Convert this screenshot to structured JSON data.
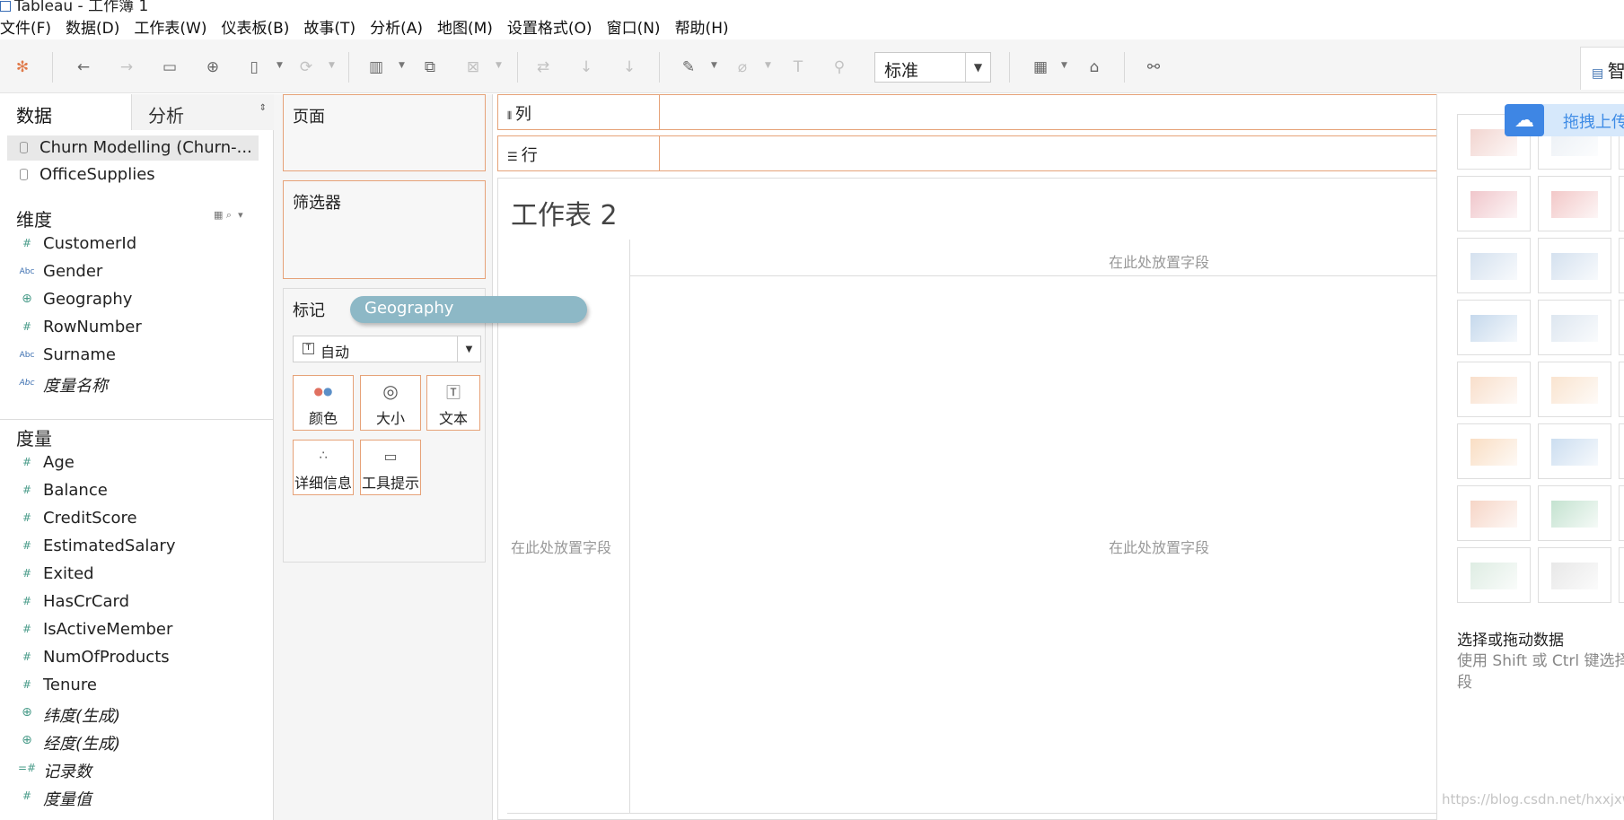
{
  "window": {
    "title": "Tableau - 工作簿 1"
  },
  "menu": [
    "文件(F)",
    "数据(D)",
    "工作表(W)",
    "仪表板(B)",
    "故事(T)",
    "分析(A)",
    "地图(M)",
    "设置格式(O)",
    "窗口(N)",
    "帮助(H)"
  ],
  "toolbar": {
    "view_mode": "标准",
    "smart_tab": "智"
  },
  "left_pane": {
    "tabs": {
      "data": "数据",
      "analysis": "分析"
    },
    "data_sources": [
      "Churn Modelling (Churn-...",
      "OfficeSupplies"
    ],
    "dimensions_header": "维度",
    "dimensions": [
      {
        "name": "CustomerId",
        "icon": "number-icon",
        "italic": false
      },
      {
        "name": "Gender",
        "icon": "string-abc-icon",
        "italic": false
      },
      {
        "name": "Geography",
        "icon": "globe-icon",
        "italic": false
      },
      {
        "name": "RowNumber",
        "icon": "number-icon",
        "italic": false
      },
      {
        "name": "Surname",
        "icon": "string-abc-icon",
        "italic": false
      },
      {
        "name": "度量名称",
        "icon": "string-abc-icon",
        "italic": true
      }
    ],
    "measures_header": "度量",
    "measures": [
      {
        "name": "Age",
        "icon": "number-icon",
        "italic": false
      },
      {
        "name": "Balance",
        "icon": "number-icon",
        "italic": false
      },
      {
        "name": "CreditScore",
        "icon": "number-icon",
        "italic": false
      },
      {
        "name": "EstimatedSalary",
        "icon": "number-icon",
        "italic": false
      },
      {
        "name": "Exited",
        "icon": "number-icon",
        "italic": false
      },
      {
        "name": "HasCrCard",
        "icon": "number-icon",
        "italic": false
      },
      {
        "name": "IsActiveMember",
        "icon": "number-icon",
        "italic": false
      },
      {
        "name": "NumOfProducts",
        "icon": "number-icon",
        "italic": false
      },
      {
        "name": "Tenure",
        "icon": "number-icon",
        "italic": false
      },
      {
        "name": "纬度(生成)",
        "icon": "globe-icon",
        "italic": true
      },
      {
        "name": "经度(生成)",
        "icon": "globe-icon",
        "italic": true
      },
      {
        "name": "记录数",
        "icon": "number-icon",
        "italic": true
      },
      {
        "name": "度量值",
        "icon": "number-icon",
        "italic": true
      }
    ]
  },
  "shelves": {
    "pages": "页面",
    "filters": "筛选器",
    "marks": "标记",
    "mark_type": "自动",
    "mark_buttons": [
      "颜色",
      "大小",
      "文本",
      "详细信息",
      "工具提示"
    ],
    "columns": "列",
    "rows": "行",
    "dragging_pill": "Geography"
  },
  "canvas": {
    "sheet_title": "工作表 2",
    "drop_top": "在此处放置字段",
    "drop_left": "在此处放置字段",
    "drop_center": "在此处放置字段"
  },
  "show_me": {
    "hint_title": "选择或拖动数据",
    "hint_body_1": "使用 Shift 或 Ctrl 键选择",
    "hint_body_2": "段",
    "cloud_button": "拖拽上传"
  },
  "watermark": "https://blog.csdn.net/hxxjxw",
  "colors": {
    "accent_orange": "#e6a278",
    "pill": "#8db8c6",
    "cloud_blue": "#3e86e4"
  }
}
